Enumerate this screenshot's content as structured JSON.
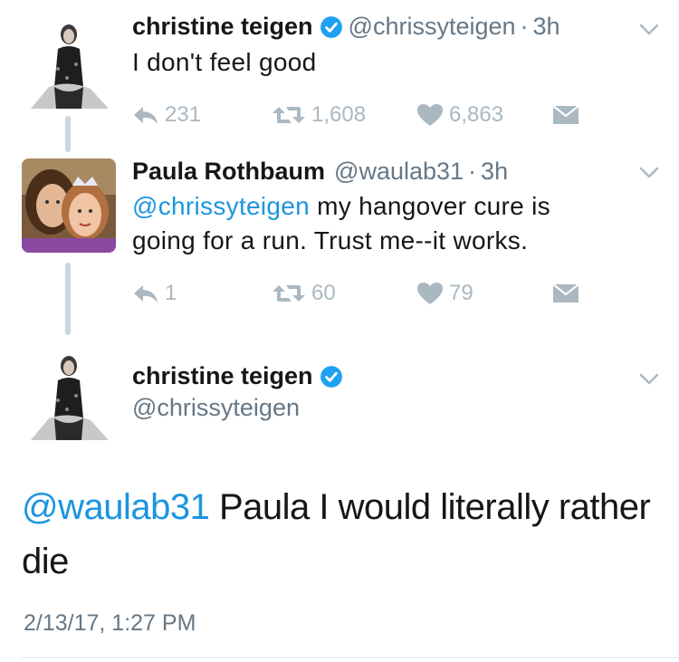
{
  "tweets": [
    {
      "name": "christine teigen",
      "handle": "@chrissyteigen",
      "time": "3h",
      "verified": true,
      "text": "I don't feel good",
      "replies": "231",
      "retweets": "1,608",
      "likes": "6,863"
    },
    {
      "name": "Paula Rothbaum",
      "handle": "@waulab31",
      "time": "3h",
      "verified": false,
      "mention": "@chrissyteigen",
      "text_line1_rest": " my hangover cure is",
      "text_line2": "going for a run. Trust me--it works.",
      "replies": "1",
      "retweets": "60",
      "likes": "79"
    }
  ],
  "main_tweet": {
    "name": "christine teigen",
    "handle": "@chrissyteigen",
    "verified": true,
    "mention": "@waulab31",
    "text_rest": " Paula I would literally rather die",
    "timestamp": "2/13/17, 1:27 PM"
  },
  "colors": {
    "link": "#1b95e0",
    "verified": "#1da1f2",
    "muted": "#657786",
    "action": "#aab8c2",
    "thread": "#ccd6dd"
  },
  "icons": {
    "reply": "reply-icon",
    "retweet": "retweet-icon",
    "like": "heart-icon",
    "dm": "envelope-icon",
    "more": "chevron-down-icon",
    "verified": "verified-badge-icon"
  }
}
